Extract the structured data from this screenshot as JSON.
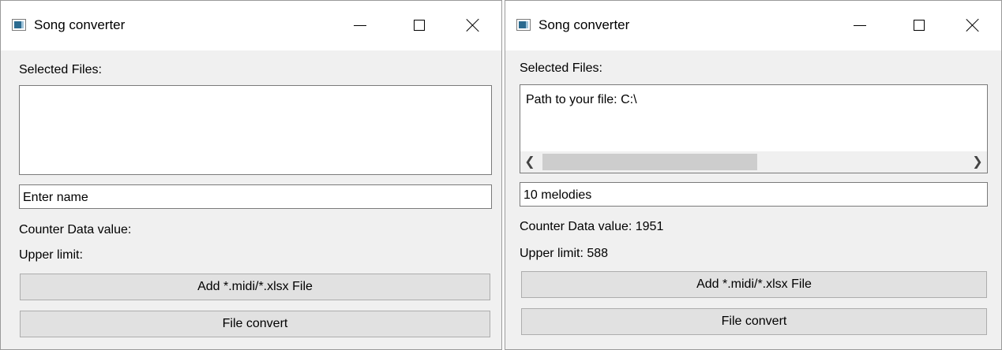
{
  "windows": [
    {
      "title": "Song converter",
      "selected_files_label": "Selected Files:",
      "file_list_text": "",
      "name_input_value": "Enter name",
      "counter_label": "Counter Data value:",
      "upper_limit_label": "Upper limit:",
      "add_button_label": "Add *.midi/*.xlsx File",
      "convert_button_label": "File convert"
    },
    {
      "title": "Song converter",
      "selected_files_label": "Selected Files:",
      "file_list_text": "Path to your file: C:\\",
      "name_input_value": "10 melodies",
      "counter_label": "Counter Data value: 1951",
      "upper_limit_label": "Upper limit: 588",
      "add_button_label": "Add *.midi/*.xlsx File",
      "convert_button_label": "File convert",
      "scroll_left_arrow": "❮",
      "scroll_right_arrow": "❯"
    }
  ],
  "titlebar_icons": {
    "app": "app-window-icon",
    "minimize": "minimize-icon",
    "maximize": "maximize-icon",
    "close": "close-icon"
  },
  "colors": {
    "window_background": "#f0f0f0",
    "titlebar_background": "#ffffff",
    "button_face": "#e1e1e1",
    "button_border": "#adadad",
    "scroll_thumb": "#cdcdcd"
  }
}
